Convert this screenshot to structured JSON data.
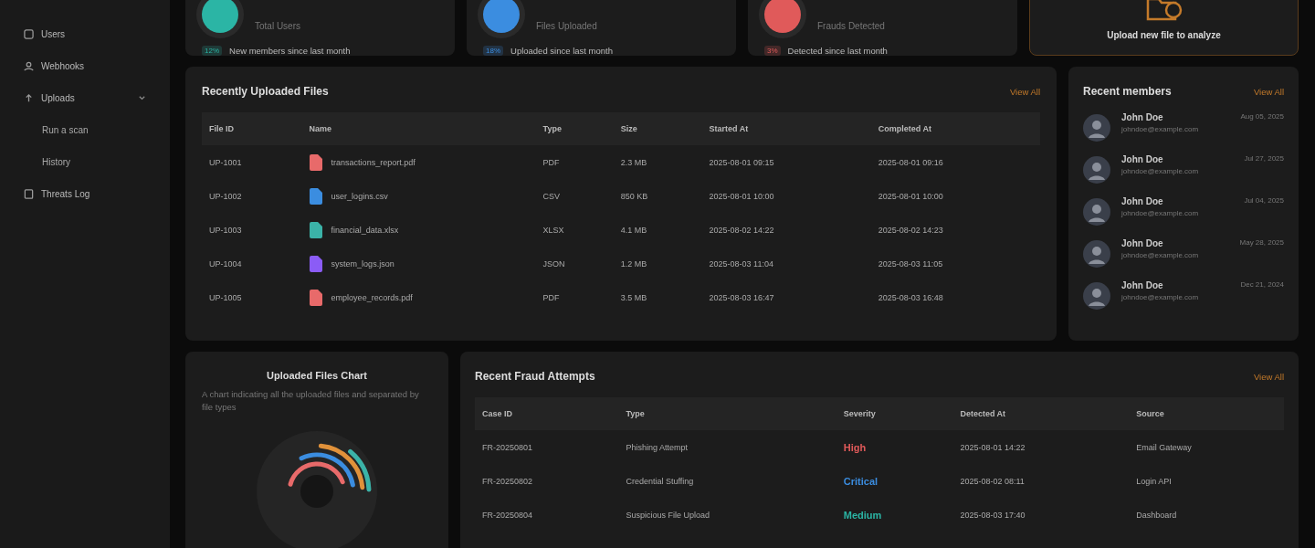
{
  "sidebar": {
    "items": [
      {
        "label": "Users"
      },
      {
        "label": "Webhooks"
      },
      {
        "label": "Uploads",
        "expanded": true,
        "children": [
          {
            "label": "Run a scan"
          },
          {
            "label": "History"
          }
        ]
      },
      {
        "label": "Threats Log"
      }
    ]
  },
  "stat_cards": [
    {
      "label": "Total Users",
      "badge": "12%",
      "note": "New members since last month",
      "color": "#2bb5a5"
    },
    {
      "label": "Files Uploaded",
      "badge": "18%",
      "note": "Uploaded since last month",
      "color": "#3b8de0"
    },
    {
      "label": "Frauds Detected",
      "badge": "3%",
      "note": "Detected since last month",
      "color": "#e05a5a"
    }
  ],
  "upload_card": {
    "label": "Upload new file to analyze"
  },
  "files": {
    "title": "Recently Uploaded Files",
    "link": "View All",
    "columns": [
      "File ID",
      "Name",
      "Type",
      "Size",
      "Started At",
      "Completed At"
    ],
    "rows": [
      {
        "id": "UP-1001",
        "name": "transactions_report.pdf",
        "type": "PDF",
        "size": "2.3 MB",
        "started": "2025-08-01 09:15",
        "completed": "2025-08-01 09:16",
        "color": "#e86a6a"
      },
      {
        "id": "UP-1002",
        "name": "user_logins.csv",
        "type": "CSV",
        "size": "850 KB",
        "started": "2025-08-01 10:00",
        "completed": "2025-08-01 10:00",
        "color": "#3b8de0"
      },
      {
        "id": "UP-1003",
        "name": "financial_data.xlsx",
        "type": "XLSX",
        "size": "4.1 MB",
        "started": "2025-08-02 14:22",
        "completed": "2025-08-02 14:23",
        "color": "#3bb3a8"
      },
      {
        "id": "UP-1004",
        "name": "system_logs.json",
        "type": "JSON",
        "size": "1.2 MB",
        "started": "2025-08-03 11:04",
        "completed": "2025-08-03 11:05",
        "color": "#8b5cf6"
      },
      {
        "id": "UP-1005",
        "name": "employee_records.pdf",
        "type": "PDF",
        "size": "3.5 MB",
        "started": "2025-08-03 16:47",
        "completed": "2025-08-03 16:48",
        "color": "#e86a6a"
      }
    ]
  },
  "members": {
    "title": "Recent members",
    "link": "View All",
    "items": [
      {
        "name": "John Doe",
        "email": "johndoe@example.com",
        "date": "Aug 05, 2025"
      },
      {
        "name": "John Doe",
        "email": "johndoe@example.com",
        "date": "Jul 27, 2025"
      },
      {
        "name": "John Doe",
        "email": "johndoe@example.com",
        "date": "Jul 04, 2025"
      },
      {
        "name": "John Doe",
        "email": "johndoe@example.com",
        "date": "May 28, 2025"
      },
      {
        "name": "John Doe",
        "email": "johndoe@example.com",
        "date": "Dec 21, 2024"
      }
    ]
  },
  "chart_card": {
    "title": "Uploaded Files Chart",
    "subtitle": "A chart indicating all the uploaded files and separated by file types"
  },
  "frauds": {
    "title": "Recent Fraud Attempts",
    "link": "View All",
    "columns": [
      "Case ID",
      "Type",
      "Severity",
      "Detected At",
      "Source"
    ],
    "rows": [
      {
        "id": "FR-20250801",
        "type": "Phishing Attempt",
        "severity": "High",
        "color": "#e05a5a",
        "detected": "2025-08-01 14:22",
        "source": "Email Gateway"
      },
      {
        "id": "FR-20250802",
        "type": "Credential Stuffing",
        "severity": "Critical",
        "color": "#3b8de0",
        "detected": "2025-08-02 08:11",
        "source": "Login API"
      },
      {
        "id": "FR-20250804",
        "type": "Suspicious File Upload",
        "severity": "Medium",
        "color": "#2bb5a5",
        "detected": "2025-08-03 17:40",
        "source": "Dashboard"
      }
    ]
  }
}
